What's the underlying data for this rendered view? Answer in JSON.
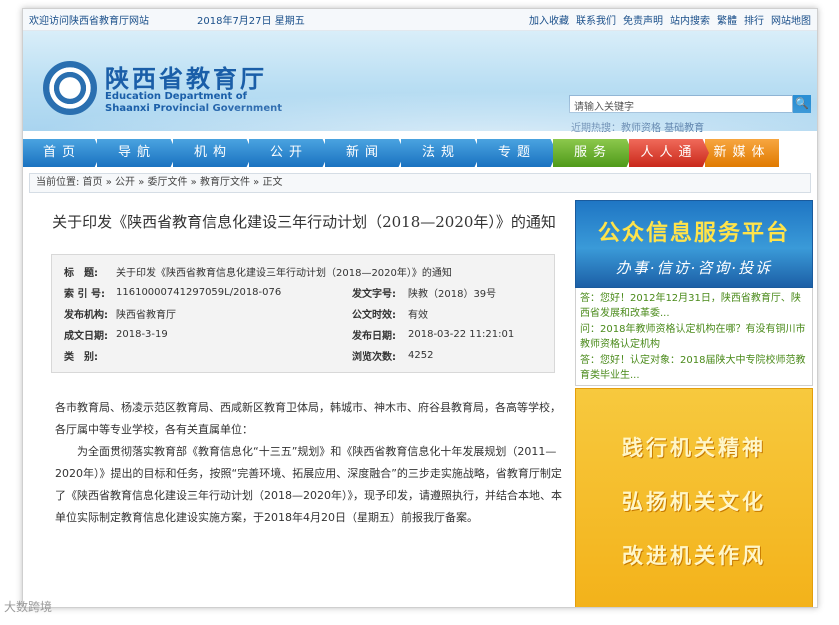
{
  "topbar": {
    "welcome": "欢迎访问陕西省教育厅网站",
    "date": "2018年7月27日 星期五",
    "links": [
      "加入收藏",
      "联系我们",
      "免责声明",
      "站内搜索",
      "繁體",
      "排行",
      "网站地图"
    ]
  },
  "header": {
    "logo_cn": "陕西省教育厅",
    "logo_en_1": "Education Department of",
    "logo_en_2": "Shaanxi Provincial Government",
    "search_placeholder": "请输入关键字",
    "search_icon_glyph": "🔍",
    "hot_search": "近期热搜：教师资格 基础教育"
  },
  "nav": [
    "首页",
    "导航",
    "机构",
    "公开",
    "新闻",
    "法规",
    "专题",
    "服务",
    "人人通",
    "新媒体"
  ],
  "breadcrumb": "当前位置: 首页 » 公开 » 委厅文件 » 教育厅文件 » 正文",
  "article": {
    "title": "关于印发《陕西省教育信息化建设三年行动计划（2018—2020年）》的通知",
    "meta": {
      "subject_label": "标　题:",
      "subject_value": "关于印发《陕西省教育信息化建设三年行动计划（2018—2020年）》的通知",
      "index_label": "索 引 号:",
      "index_value": "11610000741297059L/2018-076",
      "docno_label": "发文字号:",
      "docno_value": "陕教（2018）39号",
      "org_label": "发布机构:",
      "org_value": "陕西省教育厅",
      "validity_label": "公文时效:",
      "validity_value": "有效",
      "written_label": "成文日期:",
      "written_value": "2018-3-19",
      "pub_label": "发布日期:",
      "pub_value": "2018-03-22 11:21:01",
      "cat_label": "类　别:",
      "cat_value": "",
      "views_label": "浏览次数:",
      "views_value": "4252"
    },
    "body_p1": "各市教育局、杨凌示范区教育局、西咸新区教育卫体局，韩城市、神木市、府谷县教育局，各高等学校，各厅属中等专业学校，各有关直属单位：",
    "body_p2": "为全面贯彻落实教育部《教育信息化“十三五”规划》和《陕西省教育信息化十年发展规划（2011—2020年）》提出的目标和任务，按照“完善环境、拓展应用、深度融合”的三步走实施战略，省教育厅制定了《陕西省教育信息化建设三年行动计划（2018—2020年）》，现予印发，请遵照执行，并结合本地、本单位实际制定教育信息化建设实施方案，于2018年4月20日（星期五）前报我厅备案。"
  },
  "sidebar": {
    "banner_title": "公众信息服务平台",
    "banner_sub": "办事·信访·咨询·投诉",
    "notices": [
      "答：您好！2012年12月31日，陕西省教育厅、陕西省发展和改革委...",
      "问：2018年教师资格认定机构在哪？有没有铜川市教师资格认定机构",
      "答：您好！认定对象：2018届陕大中专院校师范教育类毕业生..."
    ],
    "slogans": [
      "践行机关精神",
      "弘扬机关文化",
      "改进机关作风"
    ]
  },
  "watermark": "大数跨境"
}
